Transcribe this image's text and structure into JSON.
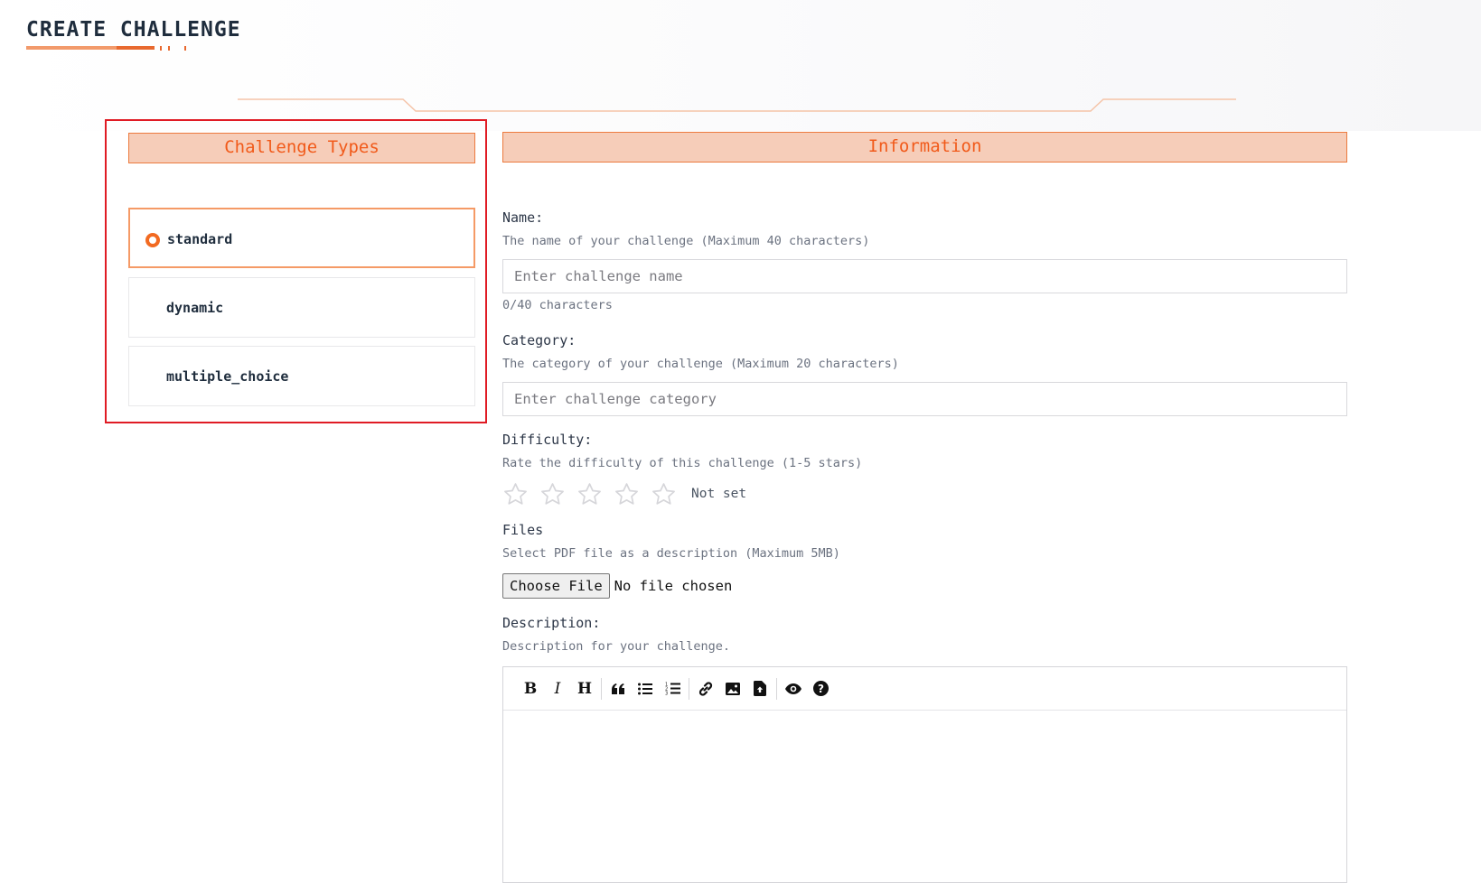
{
  "page": {
    "title": "CREATE CHALLENGE"
  },
  "challenge_types": {
    "header": "Challenge Types",
    "options": [
      {
        "label": "standard",
        "selected": true
      },
      {
        "label": "dynamic",
        "selected": false
      },
      {
        "label": "multiple_choice",
        "selected": false
      }
    ]
  },
  "information": {
    "header": "Information",
    "name": {
      "label": "Name:",
      "hint": "The name of your challenge (Maximum 40 characters)",
      "placeholder": "Enter challenge name",
      "value": "",
      "counter": "0/40 characters"
    },
    "category": {
      "label": "Category:",
      "hint": "The category of your challenge (Maximum 20 characters)",
      "placeholder": "Enter challenge category",
      "value": ""
    },
    "difficulty": {
      "label": "Difficulty:",
      "hint": "Rate the difficulty of this challenge (1-5 stars)",
      "rating": 0,
      "max_rating": 5,
      "status": "Not set"
    },
    "files": {
      "label": "Files",
      "hint": "Select PDF file as a description (Maximum 5MB)",
      "button_label": "Choose File",
      "status": "No file chosen"
    },
    "description": {
      "label": "Description:",
      "hint": "Description for your challenge.",
      "value": "",
      "toolbar": [
        {
          "name": "bold",
          "glyph": "B"
        },
        {
          "name": "italic",
          "glyph": "I"
        },
        {
          "name": "heading",
          "glyph": "H"
        },
        {
          "name": "quote-icon"
        },
        {
          "name": "unordered-list-icon"
        },
        {
          "name": "ordered-list-icon"
        },
        {
          "name": "link-icon"
        },
        {
          "name": "image-icon"
        },
        {
          "name": "upload-file-icon"
        },
        {
          "name": "preview-eye-icon"
        },
        {
          "name": "help-icon"
        }
      ]
    }
  },
  "colors": {
    "accent": "#f15a1a",
    "header_bg": "#f6cdb9",
    "highlight_border": "#e01b24",
    "selected_border": "#f59a66"
  }
}
